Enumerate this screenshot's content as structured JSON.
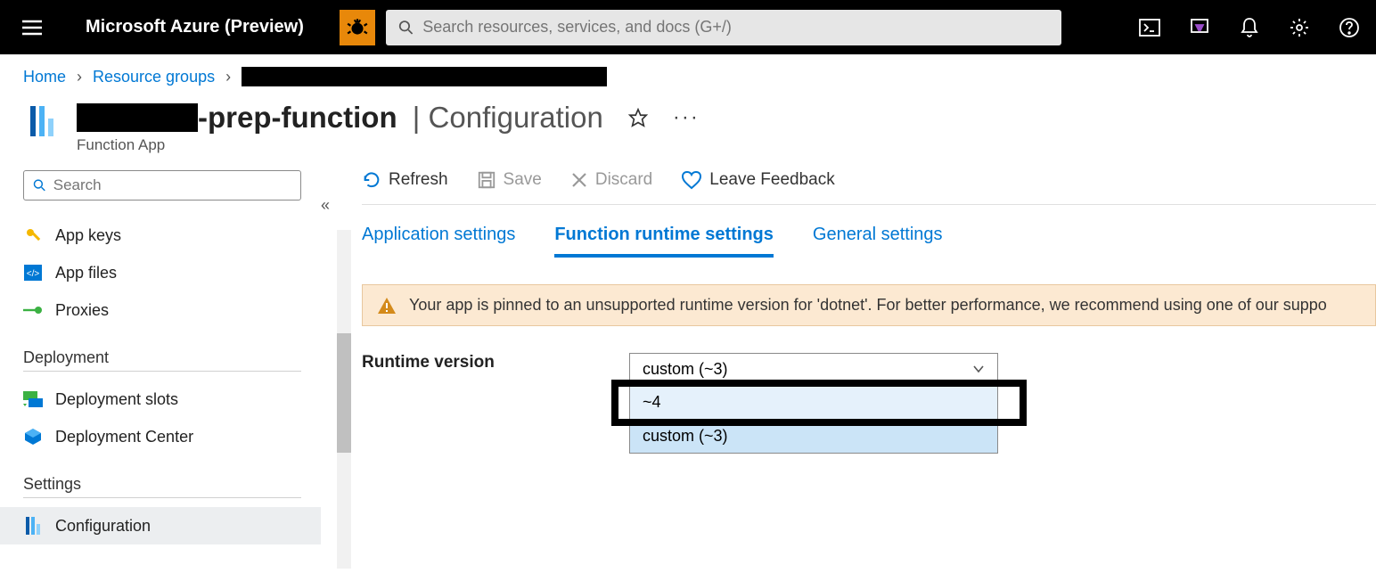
{
  "header": {
    "brand": "Microsoft Azure (Preview)",
    "search_placeholder": "Search resources, services, and docs (G+/)"
  },
  "breadcrumb": {
    "home": "Home",
    "resource_groups": "Resource groups"
  },
  "page": {
    "title_suffix": "-prep-function",
    "title_section": "Configuration",
    "subtitle": "Function App"
  },
  "sidebar": {
    "search_placeholder": "Search",
    "items": {
      "app_keys": "App keys",
      "app_files": "App files",
      "proxies": "Proxies"
    },
    "section_deployment": "Deployment",
    "deployment_items": {
      "deployment_slots": "Deployment slots",
      "deployment_center": "Deployment Center"
    },
    "section_settings": "Settings",
    "settings_items": {
      "configuration": "Configuration"
    }
  },
  "toolbar": {
    "refresh": "Refresh",
    "save": "Save",
    "discard": "Discard",
    "feedback": "Leave Feedback"
  },
  "tabs": {
    "app_settings": "Application settings",
    "runtime_settings": "Function runtime settings",
    "general_settings": "General settings"
  },
  "warning": {
    "text": "Your app is pinned to an unsupported runtime version for 'dotnet'. For better performance, we recommend using one of our suppo"
  },
  "runtime": {
    "label": "Runtime version",
    "selected": "custom (~3)",
    "options": {
      "v4": "~4",
      "custom3": "custom (~3)"
    }
  }
}
